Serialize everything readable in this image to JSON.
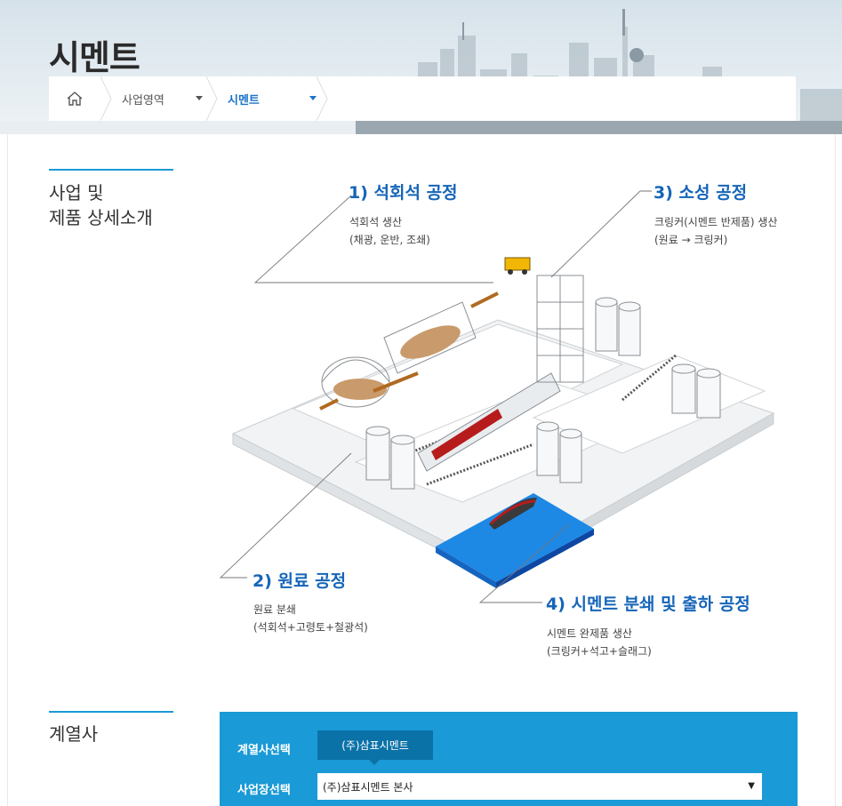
{
  "header": {
    "title": "시멘트",
    "breadcrumb": {
      "home_icon": "home-icon",
      "items": [
        {
          "label": "사업영역"
        },
        {
          "label": "시멘트"
        }
      ]
    }
  },
  "details": {
    "section_title_line1": "사업 및",
    "section_title_line2": "제품 상세소개",
    "processes": [
      {
        "title": "1) 석회석 공정",
        "desc1": "석회석 생산",
        "desc2": "(채광, 운반, 조쇄)"
      },
      {
        "title": "2) 원료 공정",
        "desc1": "원료 분쇄",
        "desc2": "(석회석+고령토+철광석)"
      },
      {
        "title": "3) 소성 공정",
        "desc1": "크링커(시멘트 반제품) 생산",
        "desc2": "(원료 → 크링커)"
      },
      {
        "title": "4) 시멘트 분쇄 및 출하 공정",
        "desc1": "시멘트 완제품 생산",
        "desc2": "(크링커+석고+슬래그)"
      }
    ]
  },
  "affiliates": {
    "section_title": "계열사",
    "company_label": "계열사선택",
    "company_selected": "(주)삼표시멘트",
    "site_label": "사업장선택",
    "site_selected": "(주)삼표시멘트 본사"
  },
  "colors": {
    "accent": "#1a9ad6",
    "title_blue": "#1565b8",
    "chip_dark": "#0b72a8",
    "water": "#1e88e5"
  }
}
